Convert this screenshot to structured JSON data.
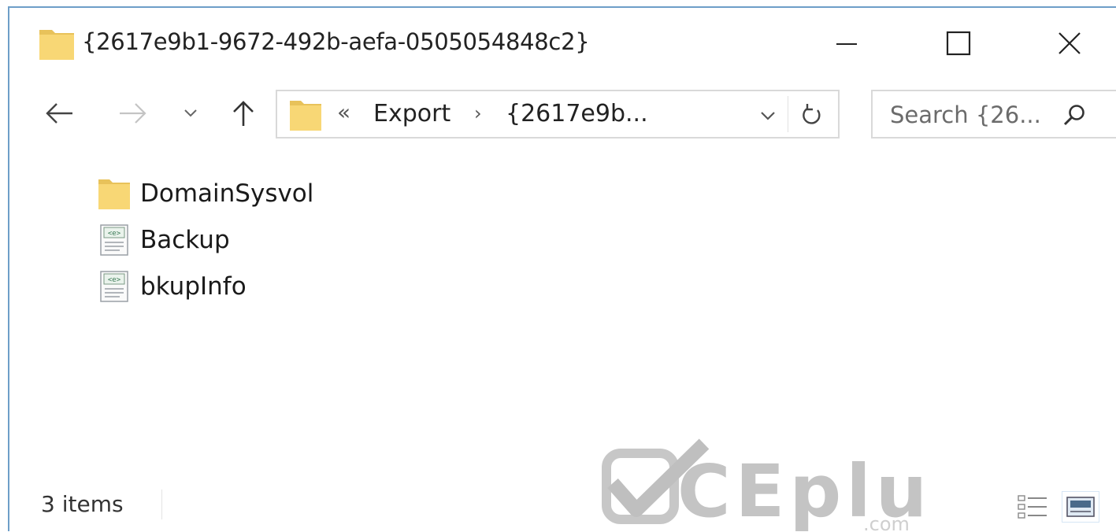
{
  "window": {
    "title": "{2617e9b1-9672-492b-aefa-0505054848c2}",
    "folder_icon": "folder-icon",
    "controls": {
      "minimize_icon": "minimize-icon",
      "maximize_icon": "maximize-icon",
      "close_icon": "close-icon"
    }
  },
  "navigation": {
    "back_icon": "arrow-left-icon",
    "forward_icon": "arrow-right-icon",
    "recent_icon": "chevron-down-icon",
    "up_icon": "arrow-up-icon"
  },
  "address_bar": {
    "overflow_glyph": "«",
    "breadcrumb": [
      "Export",
      "{2617e9b..."
    ],
    "separator_glyph": "›",
    "dropdown_icon": "chevron-down-icon",
    "refresh_icon": "refresh-icon"
  },
  "search": {
    "placeholder": "Search {26...",
    "icon": "search-icon"
  },
  "files": [
    {
      "name": "DomainSysvol",
      "type": "folder",
      "icon": "folder-icon"
    },
    {
      "name": "Backup",
      "type": "xml-document",
      "icon": "xml-file-icon"
    },
    {
      "name": "bkupInfo",
      "type": "xml-document",
      "icon": "xml-file-icon"
    }
  ],
  "status_bar": {
    "item_count": "3 items",
    "view_buttons": [
      "details-view-icon",
      "large-icons-view-icon"
    ]
  },
  "watermark": {
    "text": "CEplus",
    "suffix": ".com"
  },
  "colors": {
    "folder_yellow": "#f8d775",
    "window_border": "#6e9ec8",
    "watermark_gray": "#bdbdbd"
  }
}
